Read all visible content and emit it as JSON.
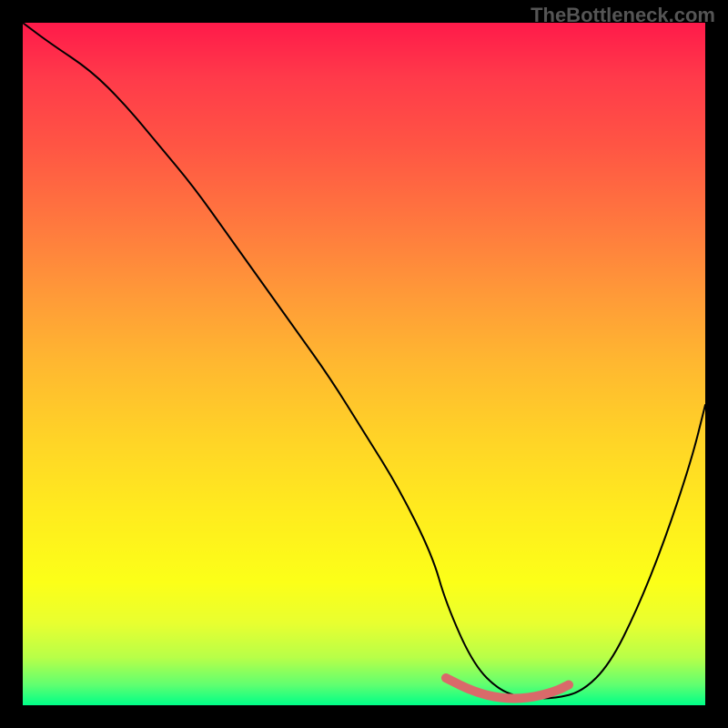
{
  "watermark": "TheBottleneck.com",
  "chart_data": {
    "type": "line",
    "title": "",
    "xlabel": "",
    "ylabel": "",
    "xlim": [
      0,
      100
    ],
    "ylim": [
      0,
      100
    ],
    "series": [
      {
        "name": "bottleneck-curve",
        "x": [
          0,
          4,
          10,
          15,
          20,
          25,
          30,
          35,
          40,
          45,
          50,
          55,
          60,
          62,
          66,
          70,
          74,
          78,
          82,
          86,
          90,
          94,
          98,
          100
        ],
        "values": [
          100,
          97,
          93,
          88,
          82,
          76,
          69,
          62,
          55,
          48,
          40,
          32,
          22,
          15,
          6,
          2,
          1,
          1,
          2,
          6,
          14,
          24,
          36,
          44
        ]
      },
      {
        "name": "highlight-band",
        "x": [
          62,
          66,
          70,
          74,
          78,
          80
        ],
        "values": [
          4,
          2,
          1,
          1,
          2,
          3
        ]
      }
    ],
    "gradient_stops": [
      {
        "pos": 0,
        "color": "#ff1a4a"
      },
      {
        "pos": 50,
        "color": "#ffb830"
      },
      {
        "pos": 82,
        "color": "#fcff18"
      },
      {
        "pos": 100,
        "color": "#00ff88"
      }
    ],
    "highlight_color": "#d96a6a"
  }
}
